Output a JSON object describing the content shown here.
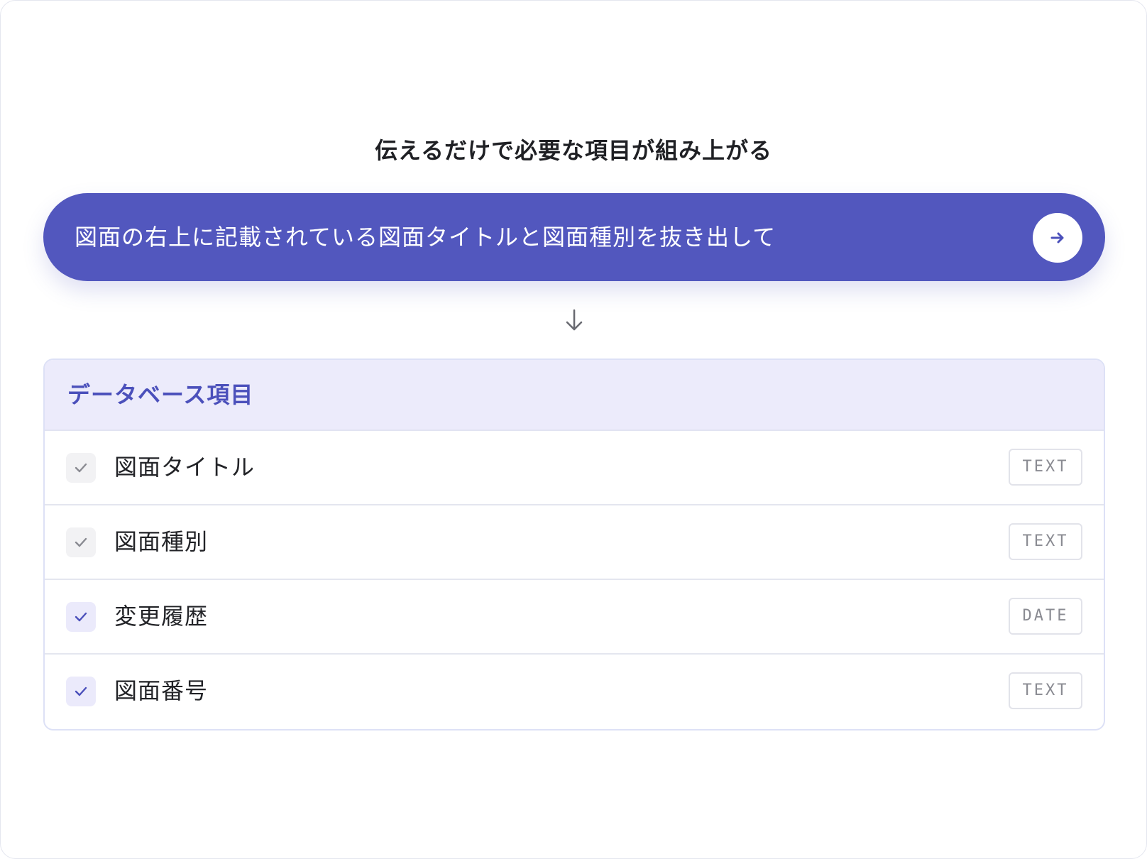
{
  "headline": "伝えるだけで必要な項目が組み上がる",
  "prompt": {
    "text": "図面の右上に記載されている図面タイトルと図面種別を抜き出して",
    "send_icon": "arrow-right-icon"
  },
  "connector_icon": "arrow-down-icon",
  "database": {
    "title": "データベース項目",
    "fields": [
      {
        "label": "図面タイトル",
        "type": "TEXT",
        "checked": true,
        "style": "muted"
      },
      {
        "label": "図面種別",
        "type": "TEXT",
        "checked": true,
        "style": "muted"
      },
      {
        "label": "変更履歴",
        "type": "DATE",
        "checked": true,
        "style": "active"
      },
      {
        "label": "図面番号",
        "type": "TEXT",
        "checked": true,
        "style": "active"
      }
    ]
  },
  "colors": {
    "accent": "#5257be",
    "accent_light": "#ecebfb",
    "check_muted": "#8a8b92",
    "check_active": "#4b50bb"
  }
}
